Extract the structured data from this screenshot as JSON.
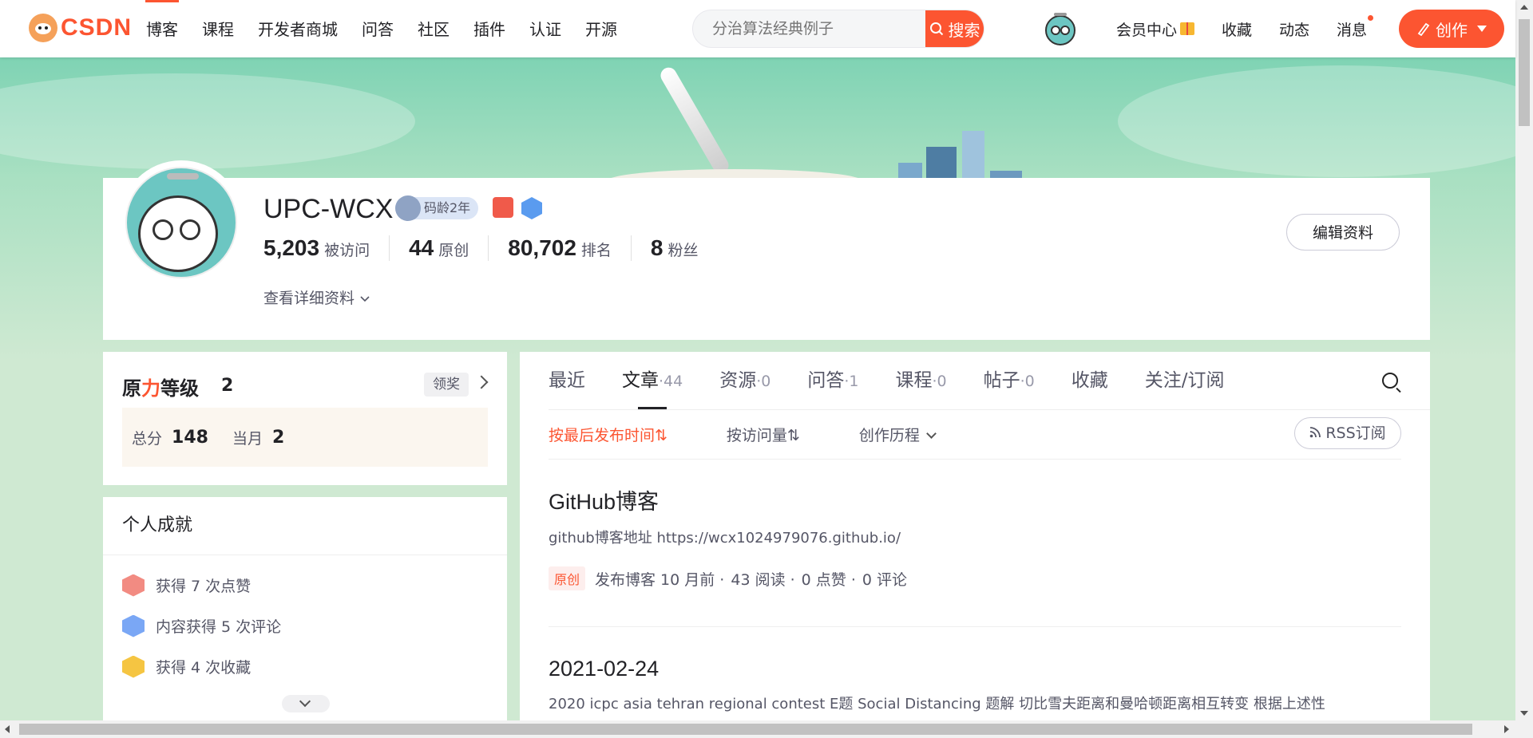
{
  "nav": {
    "logo_text": "CSDN",
    "items": [
      "博客",
      "课程",
      "开发者商城",
      "问答",
      "社区",
      "插件",
      "认证",
      "开源"
    ],
    "active_index": 0
  },
  "search": {
    "placeholder": "分治算法经典例子",
    "button_label": "搜索"
  },
  "right_nav": {
    "member": "会员中心",
    "favorites": "收藏",
    "updates": "动态",
    "messages": "消息",
    "create": "创作"
  },
  "profile": {
    "username": "UPC-WCX",
    "code_age": "码龄2年",
    "stats": [
      {
        "num": "5,203",
        "label": "被访问"
      },
      {
        "num": "44",
        "label": "原创"
      },
      {
        "num": "80,702",
        "label": "排名"
      },
      {
        "num": "8",
        "label": "粉丝"
      }
    ],
    "detail_link": "查看详细资料",
    "edit_button": "编辑资料"
  },
  "level": {
    "title_a": "原",
    "title_b": "力",
    "title_c": "等级",
    "value": "2",
    "claim": "领奖",
    "total_label": "总分",
    "total_value": "148",
    "month_label": "当月",
    "month_value": "2"
  },
  "achievements": {
    "title": "个人成就",
    "items": [
      {
        "text": "获得 7 次点赞",
        "icon": "like-badge-icon"
      },
      {
        "text": "内容获得 5 次评论",
        "icon": "comment-badge-icon"
      },
      {
        "text": "获得 4 次收藏",
        "icon": "star-badge-icon"
      }
    ]
  },
  "tabs": [
    {
      "label": "最近",
      "count": ""
    },
    {
      "label": "文章",
      "count": "·44"
    },
    {
      "label": "资源",
      "count": "·0"
    },
    {
      "label": "问答",
      "count": "·1"
    },
    {
      "label": "课程",
      "count": "·0"
    },
    {
      "label": "帖子",
      "count": "·0"
    },
    {
      "label": "收藏",
      "count": ""
    },
    {
      "label": "关注/订阅",
      "count": ""
    }
  ],
  "active_tab": 1,
  "sorts": {
    "by_time": "按最后发布时间⇅",
    "by_views": "按访问量⇅",
    "history": "创作历程",
    "rss": "RSS订阅"
  },
  "articles": [
    {
      "title": "GitHub博客",
      "desc": "github博客地址 https://wcx1024979076.github.io/",
      "tag": "原创",
      "published": "发布博客 10 月前 ·",
      "reads": "43 阅读 ·",
      "likes": "0 点赞 ·",
      "comments": "0 评论"
    },
    {
      "title": "2021-02-24",
      "desc": "2020 icpc asia tehran regional contest E题 Social Distancing 题解 切比雪夫距离和曼哈顿距离相互转变 根据上述性"
    }
  ],
  "colors": {
    "accent": "#fc5531",
    "banner": "#a9e0c2"
  }
}
